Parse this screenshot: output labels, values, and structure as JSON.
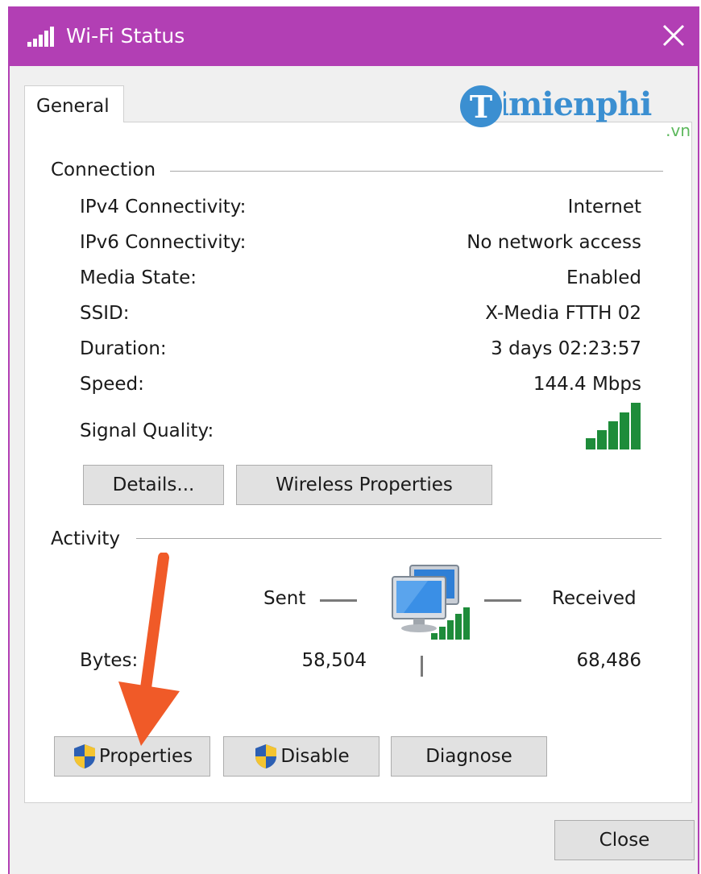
{
  "window": {
    "title": "Wi-Fi Status"
  },
  "tabs": [
    {
      "label": "General"
    }
  ],
  "watermark": {
    "text": "Taimienphi",
    "suffix": ".vn"
  },
  "connection": {
    "title": "Connection",
    "rows": [
      {
        "label": "IPv4 Connectivity:",
        "value": "Internet"
      },
      {
        "label": "IPv6 Connectivity:",
        "value": "No network access"
      },
      {
        "label": "Media State:",
        "value": "Enabled"
      },
      {
        "label": "SSID:",
        "value": "X-Media FTTH 02"
      },
      {
        "label": "Duration:",
        "value": "3 days 02:23:57"
      },
      {
        "label": "Speed:",
        "value": "144.4 Mbps"
      }
    ],
    "signal_label": "Signal Quality:",
    "signal_bars_filled": 5,
    "signal_bars_total": 5,
    "buttons": {
      "details": "Details...",
      "wireless_properties": "Wireless Properties"
    }
  },
  "activity": {
    "title": "Activity",
    "sent_label": "Sent",
    "received_label": "Received",
    "bytes_label": "Bytes:",
    "bytes_sent": "58,504",
    "bytes_received": "68,486"
  },
  "buttons": {
    "properties": "Properties",
    "disable": "Disable",
    "diagnose": "Diagnose",
    "close": "Close"
  },
  "colors": {
    "titlebar": "#b23fb4",
    "signal": "#1e8c3a",
    "arrow": "#f05a28"
  }
}
